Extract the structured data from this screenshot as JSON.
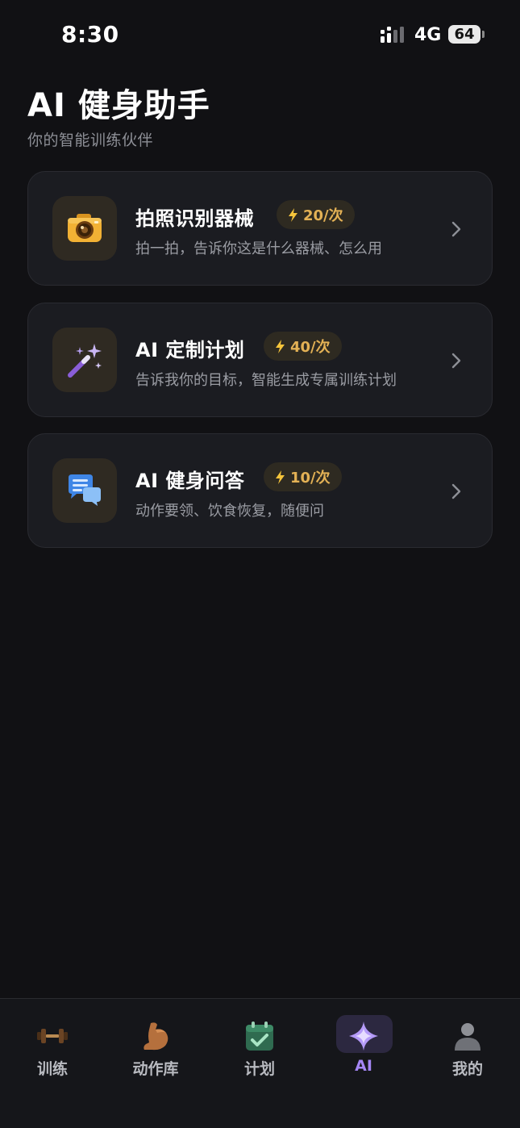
{
  "status_bar": {
    "time": "8:30",
    "network": "4G",
    "battery": "64"
  },
  "header": {
    "title": "AI 健身助手",
    "subtitle": "你的智能训练伙伴"
  },
  "cards": [
    {
      "title": "拍照识别器械",
      "cost": "20/次",
      "description": "拍一拍，告诉你这是什么器械、怎么用",
      "icon": "camera-icon"
    },
    {
      "title": "AI 定制计划",
      "cost": "40/次",
      "description": "告诉我你的目标，智能生成专属训练计划",
      "icon": "magic-wand-icon"
    },
    {
      "title": "AI 健身问答",
      "cost": "10/次",
      "description": "动作要领、饮食恢复，随便问",
      "icon": "chat-bubbles-icon"
    }
  ],
  "tabs": [
    {
      "label": "训练",
      "icon": "dumbbell-icon",
      "active": false
    },
    {
      "label": "动作库",
      "icon": "flexed-biceps-icon",
      "active": false
    },
    {
      "label": "计划",
      "icon": "calendar-check-icon",
      "active": false
    },
    {
      "label": "AI",
      "icon": "sparkle-icon",
      "active": true
    },
    {
      "label": "我的",
      "icon": "person-icon",
      "active": false
    }
  ],
  "colors": {
    "accent": "#a486f5",
    "cost": "#e3b155",
    "background": "#111114",
    "card": "#1b1c21"
  }
}
